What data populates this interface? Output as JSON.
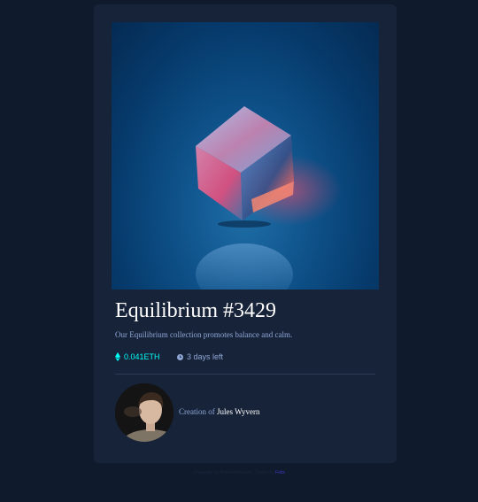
{
  "nft": {
    "title": "Equilibrium #3429",
    "description": "Our Equilibrium collection promotes balance and calm.",
    "price": "0.041ETH",
    "time_left": "3 days left",
    "image": "crystal-cube-artwork"
  },
  "creator": {
    "prefix": "Creation of",
    "name": "Jules Wyvern",
    "avatar": "creator-avatar"
  },
  "icons": {
    "price": "ethereum-icon",
    "time": "clock-icon"
  },
  "footer": {
    "text": "Challenge by Frontend Mentor. Coded by",
    "link": "Felix"
  },
  "colors": {
    "page_bg": "#0f1a2c",
    "card_bg": "#172339",
    "accent": "#00fff8",
    "soft_blue": "#8fa7d6",
    "white": "#ffffff"
  }
}
